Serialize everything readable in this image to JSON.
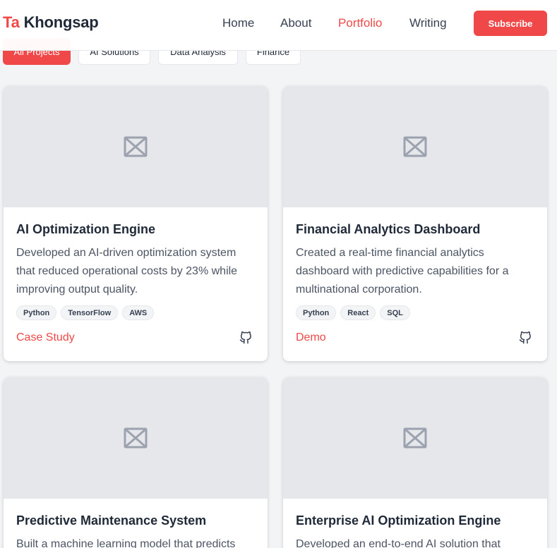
{
  "header": {
    "logo_accent": "Ta",
    "logo_rest": "Khongsap",
    "nav": {
      "home": "Home",
      "about": "About",
      "portfolio": "Portfolio",
      "writing": "Writing"
    },
    "subscribe_label": "Subscribe"
  },
  "filters": {
    "all": "All Projects",
    "ai": "AI Solutions",
    "data": "Data Analysis",
    "finance": "Finance"
  },
  "cards": [
    {
      "title": "AI Optimization Engine",
      "description": "Developed an AI-driven optimization system that reduced operational costs by 23% while improving output quality.",
      "tags": [
        "Python",
        "TensorFlow",
        "AWS"
      ],
      "link": "Case Study"
    },
    {
      "title": "Financial Analytics Dashboard",
      "description": "Created a real-time financial analytics dashboard with predictive capabilities for a multinational corporation.",
      "tags": [
        "Python",
        "React",
        "SQL"
      ],
      "link": "Demo"
    },
    {
      "title": "Predictive Maintenance System",
      "description": "Built a machine learning model that predicts"
    },
    {
      "title": "Enterprise AI Optimization Engine",
      "description": "Developed an end-to-end AI solution that"
    }
  ],
  "colors": {
    "accent": "#f04848",
    "page_bg": "#f3f4f6",
    "placeholder_bg": "#e5e7eb"
  },
  "icons": {
    "thumbnail": "image-placeholder-icon",
    "repo": "github-icon"
  }
}
